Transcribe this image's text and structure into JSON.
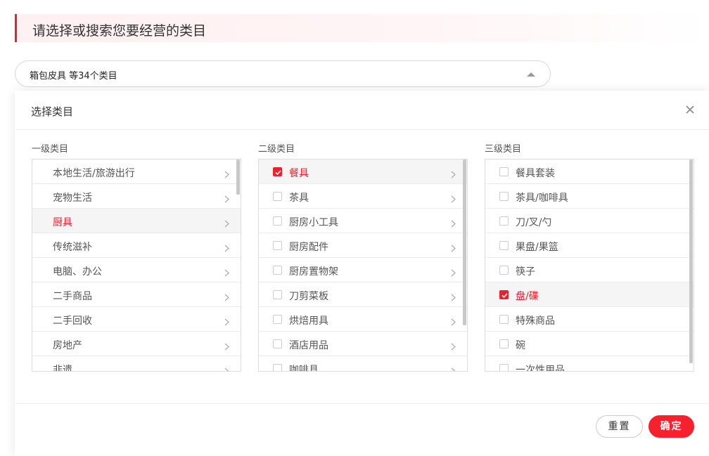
{
  "header": {
    "title": "请选择或搜索您要经营的类目"
  },
  "category_select": {
    "value": "箱包皮具 等34个类目",
    "expanded": true
  },
  "modal": {
    "title": "选择类目",
    "columns": [
      {
        "label": "一级类目",
        "items": [
          {
            "label": "本地生活/旅游出行",
            "active": false
          },
          {
            "label": "宠物生活",
            "active": false
          },
          {
            "label": "厨具",
            "active": true
          },
          {
            "label": "传统滋补",
            "active": false
          },
          {
            "label": "电脑、办公",
            "active": false
          },
          {
            "label": "二手商品",
            "active": false
          },
          {
            "label": "二手回收",
            "active": false
          },
          {
            "label": "房地产",
            "active": false
          },
          {
            "label": "非遗",
            "active": false
          }
        ]
      },
      {
        "label": "二级类目",
        "items": [
          {
            "label": "餐具",
            "checked": true,
            "active": true
          },
          {
            "label": "茶具",
            "checked": false,
            "active": false
          },
          {
            "label": "厨房小工具",
            "checked": false,
            "active": false
          },
          {
            "label": "厨房配件",
            "checked": false,
            "active": false
          },
          {
            "label": "厨房置物架",
            "checked": false,
            "active": false
          },
          {
            "label": "刀剪菜板",
            "checked": false,
            "active": false
          },
          {
            "label": "烘焙用具",
            "checked": false,
            "active": false
          },
          {
            "label": "酒店用品",
            "checked": false,
            "active": false
          },
          {
            "label": "咖啡具",
            "checked": false,
            "active": false
          }
        ]
      },
      {
        "label": "三级类目",
        "items": [
          {
            "label": "餐具套装",
            "checked": false,
            "active": false
          },
          {
            "label": "茶具/咖啡具",
            "checked": false,
            "active": false
          },
          {
            "label": "刀/叉/勺",
            "checked": false,
            "active": false
          },
          {
            "label": "果盘/果篮",
            "checked": false,
            "active": false
          },
          {
            "label": "筷子",
            "checked": false,
            "active": false
          },
          {
            "label": "盘/碟",
            "checked": true,
            "active": true
          },
          {
            "label": "特殊商品",
            "checked": false,
            "active": false
          },
          {
            "label": "碗",
            "checked": false,
            "active": false
          },
          {
            "label": "一次性用品",
            "checked": false,
            "active": false
          }
        ]
      }
    ],
    "buttons": {
      "reset": "重置",
      "confirm": "确定"
    }
  },
  "colors": {
    "accent": "#f5222d",
    "active_text": "#e8232f",
    "active_row_bg": "#f5f5f5"
  },
  "icons": {
    "close": "close-icon",
    "chevron": "chevron-right-icon",
    "dropdown": "caret-up-icon",
    "check": "check-icon"
  }
}
